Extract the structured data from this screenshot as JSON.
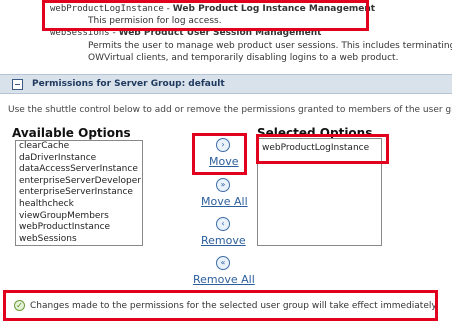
{
  "permissions": [
    {
      "name": "webProductLogInstance",
      "separator": " - ",
      "title": "Web Product Log Instance Management",
      "desc": "This permision for log access."
    },
    {
      "name": "webSessions",
      "separator": " - ",
      "title": "Web Product User Session Management",
      "desc1": "Permits the user to manage web product user sessions. This includes terminating t",
      "desc2": "OWVirtual clients, and temporarily disabling logins to a web product."
    }
  ],
  "section": {
    "title": "Permissions for Server Group: default"
  },
  "instructions": "Use the shuttle control below to add or remove the permissions granted to members of the user gro",
  "available": {
    "label": "Available Options",
    "options": [
      "clearCache",
      "daDriverInstance",
      "dataAccessServerInstance",
      "enterpriseServerDeveloper",
      "enterpriseServerInstance",
      "healthcheck",
      "viewGroupMembers",
      "webProductInstance",
      "webSessions"
    ]
  },
  "selected": {
    "label": "Selected Options",
    "options": [
      "webProductLogInstance"
    ]
  },
  "shuttle": {
    "move_icon": "›",
    "move": "Move",
    "move_all_icon": "»",
    "move_all": "Move All",
    "remove_icon": "‹",
    "remove": "Remove",
    "remove_all_icon": "«",
    "remove_all": "Remove All"
  },
  "message": "Changes made to the permissions for the selected user group will take effect immediately.",
  "colors": {
    "highlight": "#e1001e",
    "link": "#2b5e9c",
    "header": "#d9e1ea"
  },
  "icons": {
    "collapse": "collapse-icon",
    "move": "arrow-right-icon",
    "move_all": "double-arrow-right-icon",
    "remove": "arrow-left-icon",
    "remove_all": "double-arrow-left-icon",
    "check": "check-icon"
  }
}
